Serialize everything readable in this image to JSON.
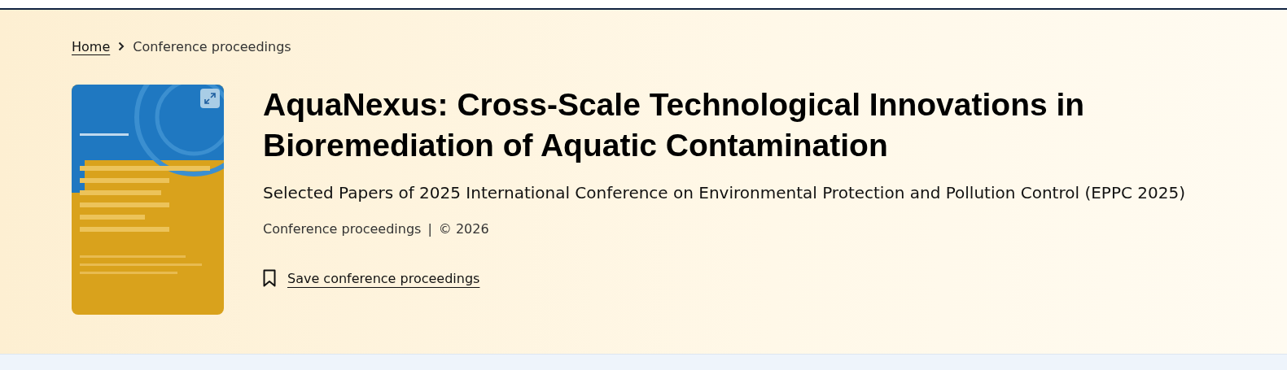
{
  "breadcrumb": [
    {
      "label": "Home",
      "kind": "link"
    },
    {
      "label": "Conference proceedings",
      "kind": "current"
    }
  ],
  "title": "AquaNexus: Cross-Scale Technological Innovations in Bioremediation of Aquatic Contamination",
  "subtitle": "Selected Papers of 2025 International Conference on Environmental Protection and Pollution Control (EPPC 2025)",
  "meta": {
    "type": "Conference proceedings",
    "separator": "|",
    "copyright": "© 2026"
  },
  "save_link": "Save conference proceedings"
}
